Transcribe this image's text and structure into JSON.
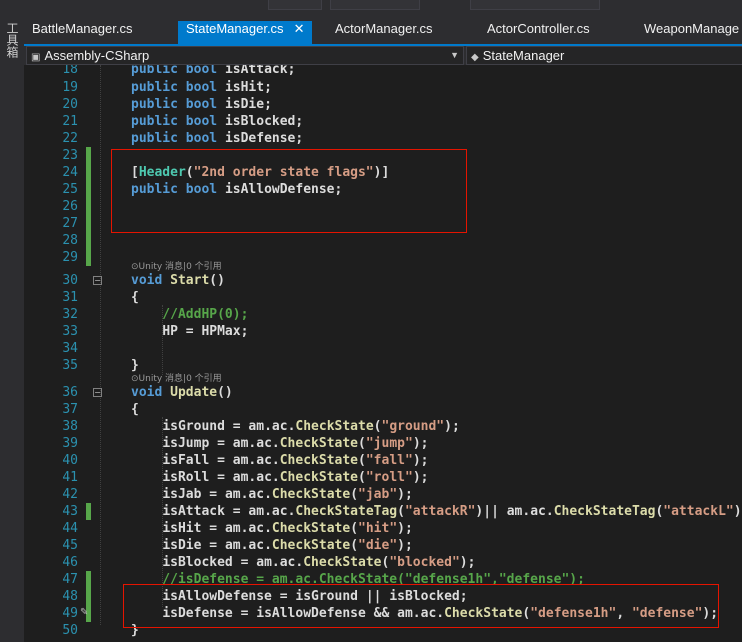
{
  "side_panel": {
    "label": "工具箱"
  },
  "tabs": [
    {
      "label": "BattleManager.cs",
      "active": false
    },
    {
      "label": "StateManager.cs",
      "active": true,
      "close": "✕"
    },
    {
      "label": "ActorManager.cs",
      "active": false
    },
    {
      "label": "ActorController.cs",
      "active": false
    },
    {
      "label": "WeaponManage",
      "active": false
    }
  ],
  "nav": {
    "project": "Assembly-CSharp",
    "class_name": "StateManager"
  },
  "codelens": {
    "start": "⊙Unity 消息|0 个引用",
    "update": "⊙Unity 消息|0 个引用"
  },
  "lines": [
    {
      "n": "18",
      "text": "public bool isAttack;"
    },
    {
      "n": "19",
      "text": "public bool isHit;"
    },
    {
      "n": "20",
      "text": "public bool isDie;"
    },
    {
      "n": "21",
      "text": "public bool isBlocked;"
    },
    {
      "n": "22",
      "text": "public bool isDefense;"
    },
    {
      "n": "23",
      "text": ""
    },
    {
      "n": "24",
      "text": "[Header(\"2nd order state flags\")]"
    },
    {
      "n": "25",
      "text": "public bool isAllowDefense;"
    },
    {
      "n": "26",
      "text": ""
    },
    {
      "n": "27",
      "text": ""
    },
    {
      "n": "28",
      "text": ""
    },
    {
      "n": "29",
      "text": ""
    },
    {
      "n": "30",
      "text": "void Start()"
    },
    {
      "n": "31",
      "text": "{"
    },
    {
      "n": "32",
      "text": "    //AddHP(0);"
    },
    {
      "n": "33",
      "text": "    HP = HPMax;"
    },
    {
      "n": "34",
      "text": ""
    },
    {
      "n": "35",
      "text": "}"
    },
    {
      "n": "36",
      "text": "void Update()"
    },
    {
      "n": "37",
      "text": "{"
    },
    {
      "n": "38",
      "text": "    isGround = am.ac.CheckState(\"ground\");"
    },
    {
      "n": "39",
      "text": "    isJump = am.ac.CheckState(\"jump\");"
    },
    {
      "n": "40",
      "text": "    isFall = am.ac.CheckState(\"fall\");"
    },
    {
      "n": "41",
      "text": "    isRoll = am.ac.CheckState(\"roll\");"
    },
    {
      "n": "42",
      "text": "    isJab = am.ac.CheckState(\"jab\");"
    },
    {
      "n": "43",
      "text": "    isAttack = am.ac.CheckStateTag(\"attackR\")|| am.ac.CheckStateTag(\"attackL\");"
    },
    {
      "n": "44",
      "text": "    isHit = am.ac.CheckState(\"hit\");"
    },
    {
      "n": "45",
      "text": "    isDie = am.ac.CheckState(\"die\");"
    },
    {
      "n": "46",
      "text": "    isBlocked = am.ac.CheckState(\"blocked\");"
    },
    {
      "n": "47",
      "text": "    //isDefense = am.ac.CheckState(\"defense1h\",\"defense\");"
    },
    {
      "n": "48",
      "text": "    isAllowDefense = isGround || isBlocked;"
    },
    {
      "n": "49",
      "text": "    isDefense = isAllowDefense && am.ac.CheckState(\"defense1h\", \"defense\");"
    },
    {
      "n": "50",
      "text": "}"
    }
  ],
  "colors": {
    "keyword": "#569cd6",
    "type": "#4ec9b0",
    "method": "#dcdcaa",
    "string": "#d69d85",
    "comment": "#57a64a",
    "line_number": "#2b91af",
    "highlight_box": "#e51400",
    "active_tab": "#007acc"
  }
}
